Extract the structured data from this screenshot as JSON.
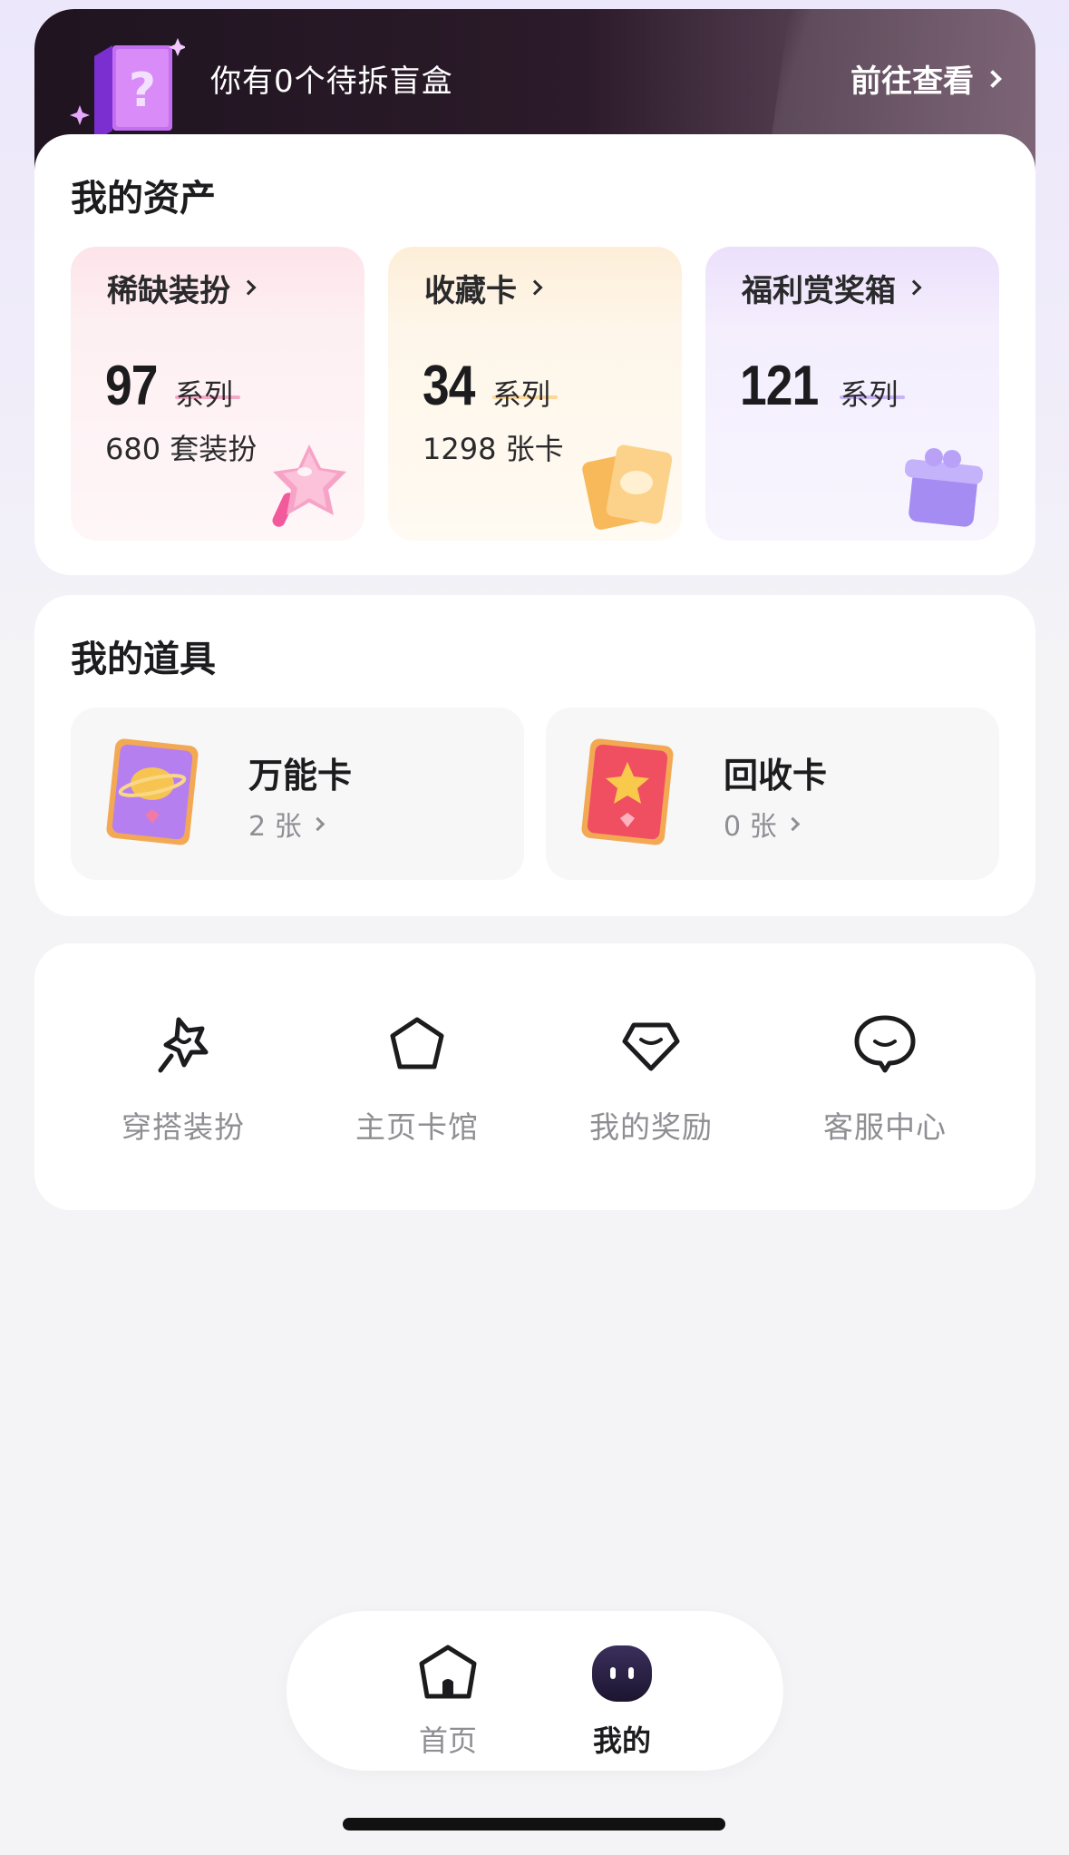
{
  "banner": {
    "title": "你有0个待拆盲盒",
    "action": "前往查看"
  },
  "assets": {
    "title": "我的资产",
    "items": [
      {
        "label": "稀缺装扮",
        "count": "97",
        "unit": "系列",
        "sub": "680 套装扮",
        "icon": "star-wand-icon"
      },
      {
        "label": "收藏卡",
        "count": "34",
        "unit": "系列",
        "sub": "1298 张卡",
        "icon": "cards-icon"
      },
      {
        "label": "福利赏奖箱",
        "count": "121",
        "unit": "系列",
        "sub": "",
        "icon": "gift-box-icon"
      }
    ]
  },
  "props": {
    "title": "我的道具",
    "items": [
      {
        "name": "万能卡",
        "count": "2 张",
        "icon": "universal-card-icon"
      },
      {
        "name": "回收卡",
        "count": "0 张",
        "icon": "recycle-card-icon"
      }
    ]
  },
  "shortcuts": [
    {
      "label": "穿搭装扮",
      "icon": "wand-star-icon"
    },
    {
      "label": "主页卡馆",
      "icon": "pentagon-icon"
    },
    {
      "label": "我的奖励",
      "icon": "gem-icon"
    },
    {
      "label": "客服中心",
      "icon": "chat-bubble-icon"
    }
  ],
  "tabbar": {
    "items": [
      {
        "label": "首页",
        "icon": "home-icon",
        "active": false
      },
      {
        "label": "我的",
        "icon": "profile-avatar-icon",
        "active": true
      }
    ]
  },
  "colors": {
    "accent_dark": "#2c2240",
    "muted_text": "#8e8e93",
    "banner_bg": "#2c1b2a"
  }
}
